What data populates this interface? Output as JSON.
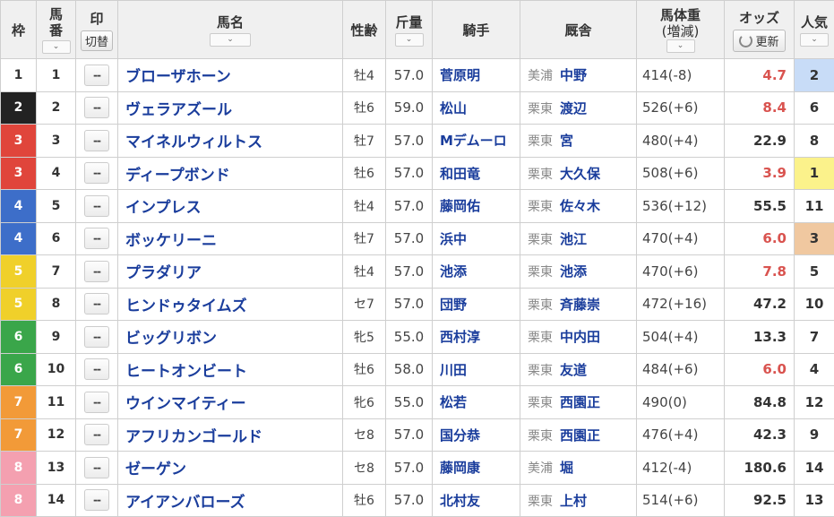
{
  "header": {
    "waku": "枠",
    "umaban_top": "馬",
    "umaban_bottom": "番",
    "mark_top": "印",
    "mark_switch": "切替",
    "horse_name": "馬名",
    "sex_age": "性齢",
    "weight": "斤量",
    "jockey": "騎手",
    "stable": "厩舎",
    "body_weight": "馬体重",
    "body_weight_sub": "(増減)",
    "odds": "オッズ",
    "refresh": "更新",
    "popularity": "人気",
    "sort_glyph": "⌄"
  },
  "colors": {
    "waku": {
      "1": "#ffffff",
      "2": "#222222",
      "3": "#e0453b",
      "4": "#3d6ec9",
      "5": "#f0d02a",
      "6": "#3aa64a",
      "7": "#f29a38",
      "8": "#f4a0b0"
    },
    "waku_text": {
      "1": "#333333",
      "2": "#ffffff",
      "3": "#ffffff",
      "4": "#ffffff",
      "5": "#ffffff",
      "6": "#ffffff",
      "7": "#ffffff",
      "8": "#ffffff"
    },
    "pop_highlight": {
      "1": "#fbf28b",
      "2": "#c8dcf7",
      "3": "#f0c8a0"
    }
  },
  "rows": [
    {
      "waku": "1",
      "num": "1",
      "mark": "--",
      "name": "ブローザホーン",
      "sex": "牡4",
      "weight": "57.0",
      "jockey": "菅原明",
      "area": "美浦",
      "trainer": "中野",
      "body": "414(-8)",
      "odds": "4.7",
      "hot": true,
      "pop": "2"
    },
    {
      "waku": "2",
      "num": "2",
      "mark": "--",
      "name": "ヴェラアズール",
      "sex": "牡6",
      "weight": "59.0",
      "jockey": "松山",
      "area": "栗東",
      "trainer": "渡辺",
      "body": "526(+6)",
      "odds": "8.4",
      "hot": true,
      "pop": "6"
    },
    {
      "waku": "3",
      "num": "3",
      "mark": "--",
      "name": "マイネルウィルトス",
      "sex": "牡7",
      "weight": "57.0",
      "jockey": "Mデムーロ",
      "area": "栗東",
      "trainer": "宮",
      "body": "480(+4)",
      "odds": "22.9",
      "hot": false,
      "pop": "8"
    },
    {
      "waku": "3",
      "num": "4",
      "mark": "--",
      "name": "ディープボンド",
      "sex": "牡6",
      "weight": "57.0",
      "jockey": "和田竜",
      "area": "栗東",
      "trainer": "大久保",
      "body": "508(+6)",
      "odds": "3.9",
      "hot": true,
      "pop": "1"
    },
    {
      "waku": "4",
      "num": "5",
      "mark": "--",
      "name": "インプレス",
      "sex": "牡4",
      "weight": "57.0",
      "jockey": "藤岡佑",
      "area": "栗東",
      "trainer": "佐々木",
      "body": "536(+12)",
      "odds": "55.5",
      "hot": false,
      "pop": "11"
    },
    {
      "waku": "4",
      "num": "6",
      "mark": "--",
      "name": "ボッケリーニ",
      "sex": "牡7",
      "weight": "57.0",
      "jockey": "浜中",
      "area": "栗東",
      "trainer": "池江",
      "body": "470(+4)",
      "odds": "6.0",
      "hot": true,
      "pop": "3"
    },
    {
      "waku": "5",
      "num": "7",
      "mark": "--",
      "name": "プラダリア",
      "sex": "牡4",
      "weight": "57.0",
      "jockey": "池添",
      "area": "栗東",
      "trainer": "池添",
      "body": "470(+6)",
      "odds": "7.8",
      "hot": true,
      "pop": "5"
    },
    {
      "waku": "5",
      "num": "8",
      "mark": "--",
      "name": "ヒンドゥタイムズ",
      "sex": "セ7",
      "weight": "57.0",
      "jockey": "団野",
      "area": "栗東",
      "trainer": "斉藤崇",
      "body": "472(+16)",
      "odds": "47.2",
      "hot": false,
      "pop": "10"
    },
    {
      "waku": "6",
      "num": "9",
      "mark": "--",
      "name": "ビッグリボン",
      "sex": "牝5",
      "weight": "55.0",
      "jockey": "西村淳",
      "area": "栗東",
      "trainer": "中内田",
      "body": "504(+4)",
      "odds": "13.3",
      "hot": false,
      "pop": "7"
    },
    {
      "waku": "6",
      "num": "10",
      "mark": "--",
      "name": "ヒートオンビート",
      "sex": "牡6",
      "weight": "58.0",
      "jockey": "川田",
      "area": "栗東",
      "trainer": "友道",
      "body": "484(+6)",
      "odds": "6.0",
      "hot": true,
      "pop": "4"
    },
    {
      "waku": "7",
      "num": "11",
      "mark": "--",
      "name": "ウインマイティー",
      "sex": "牝6",
      "weight": "55.0",
      "jockey": "松若",
      "area": "栗東",
      "trainer": "西園正",
      "body": "490(0)",
      "odds": "84.8",
      "hot": false,
      "pop": "12"
    },
    {
      "waku": "7",
      "num": "12",
      "mark": "--",
      "name": "アフリカンゴールド",
      "sex": "セ8",
      "weight": "57.0",
      "jockey": "国分恭",
      "area": "栗東",
      "trainer": "西園正",
      "body": "476(+4)",
      "odds": "42.3",
      "hot": false,
      "pop": "9"
    },
    {
      "waku": "8",
      "num": "13",
      "mark": "--",
      "name": "ゼーゲン",
      "sex": "セ8",
      "weight": "57.0",
      "jockey": "藤岡康",
      "area": "美浦",
      "trainer": "堀",
      "body": "412(-4)",
      "odds": "180.6",
      "hot": false,
      "pop": "14"
    },
    {
      "waku": "8",
      "num": "14",
      "mark": "--",
      "name": "アイアンバローズ",
      "sex": "牡6",
      "weight": "57.0",
      "jockey": "北村友",
      "area": "栗東",
      "trainer": "上村",
      "body": "514(+6)",
      "odds": "92.5",
      "hot": false,
      "pop": "13"
    }
  ]
}
